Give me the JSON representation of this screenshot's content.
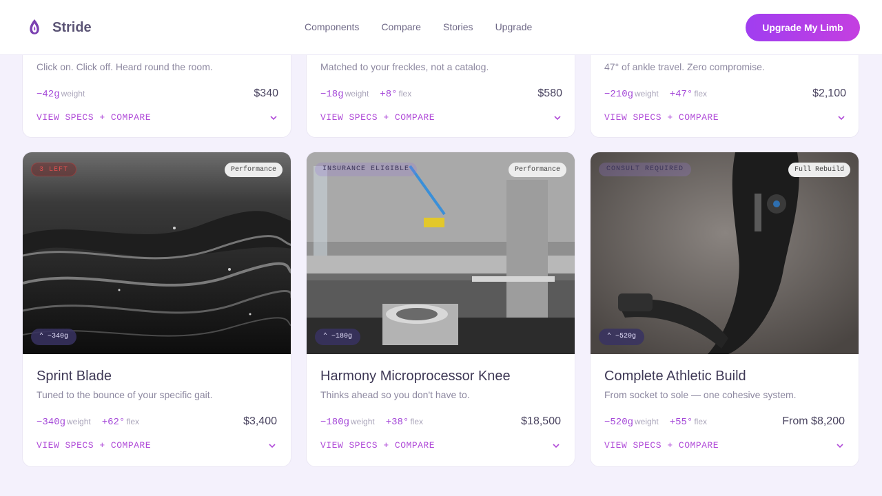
{
  "header": {
    "brand": "Stride",
    "nav": [
      "Components",
      "Compare",
      "Stories",
      "Upgrade"
    ],
    "cta": "Upgrade My Limb"
  },
  "top_cards": [
    {
      "desc": "Click on. Click off. Heard round the room.",
      "stats": [
        {
          "value": "−42g",
          "unit": "weight"
        }
      ],
      "price": "$340",
      "specs": "VIEW SPECS + COMPARE"
    },
    {
      "desc": "Matched to your freckles, not a catalog.",
      "stats": [
        {
          "value": "−18g",
          "unit": "weight"
        },
        {
          "value": "+8°",
          "unit": "flex"
        }
      ],
      "price": "$580",
      "specs": "VIEW SPECS + COMPARE"
    },
    {
      "desc": "47° of ankle travel. Zero compromise.",
      "stats": [
        {
          "value": "−210g",
          "unit": "weight"
        },
        {
          "value": "+47°",
          "unit": "flex"
        }
      ],
      "price": "$2,100",
      "specs": "VIEW SPECS + COMPARE"
    }
  ],
  "cards": [
    {
      "badge_left": "3 LEFT",
      "badge_right": "Performance",
      "delta": "⌃ −340g",
      "title": "Sprint Blade",
      "desc": "Tuned to the bounce of your specific gait.",
      "stats": [
        {
          "value": "−340g",
          "unit": "weight"
        },
        {
          "value": "+62°",
          "unit": "flex"
        }
      ],
      "price": "$3,400",
      "specs": "VIEW SPECS + COMPARE"
    },
    {
      "badge_left": "INSURANCE ELIGIBLE",
      "badge_right": "Performance",
      "delta": "⌃ −180g",
      "title": "Harmony Microprocessor Knee",
      "desc": "Thinks ahead so you don't have to.",
      "stats": [
        {
          "value": "−180g",
          "unit": "weight"
        },
        {
          "value": "+38°",
          "unit": "flex"
        }
      ],
      "price": "$18,500",
      "specs": "VIEW SPECS + COMPARE"
    },
    {
      "badge_left": "CONSULT REQUIRED",
      "badge_right": "Full Rebuild",
      "delta": "⌃ −520g",
      "title": "Complete Athletic Build",
      "desc": "From socket to sole — one cohesive system.",
      "stats": [
        {
          "value": "−520g",
          "unit": "weight"
        },
        {
          "value": "+55°",
          "unit": "flex"
        }
      ],
      "price": "From $8,200",
      "specs": "VIEW SPECS + COMPARE"
    }
  ],
  "colors": {
    "accent": "#b04bd8",
    "cta_start": "#a03ef0",
    "cta_end": "#c43fe0",
    "background": "#f4f1fc"
  }
}
